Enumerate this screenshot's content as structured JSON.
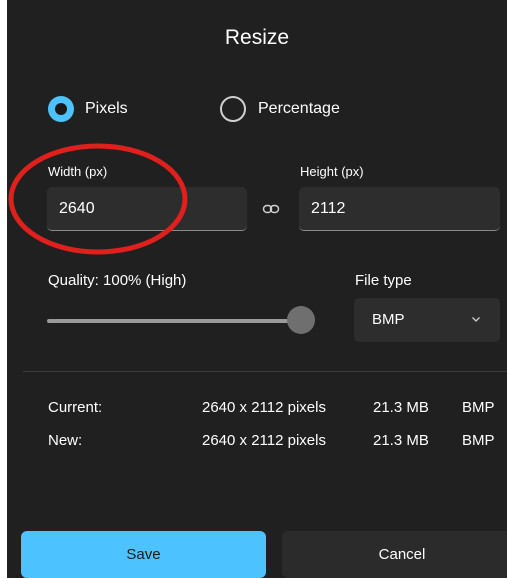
{
  "dialog": {
    "title": "Resize"
  },
  "mode": {
    "options": [
      "Pixels",
      "Percentage"
    ],
    "selected": "Pixels"
  },
  "width": {
    "label": "Width (px)",
    "value": "2640"
  },
  "height": {
    "label": "Height (px)",
    "value": "2112"
  },
  "link_icon": "link-icon",
  "quality": {
    "label": "Quality: 100% (High)",
    "level": 1.0
  },
  "file_type": {
    "label": "File type",
    "selected": "BMP"
  },
  "summary": {
    "rows": [
      {
        "label": "Current:",
        "dimensions": "2640 x 2112 pixels",
        "size": "21.3 MB",
        "format": "BMP"
      },
      {
        "label": "New:",
        "dimensions": "2640 x 2112 pixels",
        "size": "21.3 MB",
        "format": "BMP"
      }
    ]
  },
  "buttons": {
    "save": "Save",
    "cancel": "Cancel"
  },
  "colors": {
    "accent": "#4cc2ff",
    "background": "#202020",
    "annotation": "#e0201c"
  }
}
